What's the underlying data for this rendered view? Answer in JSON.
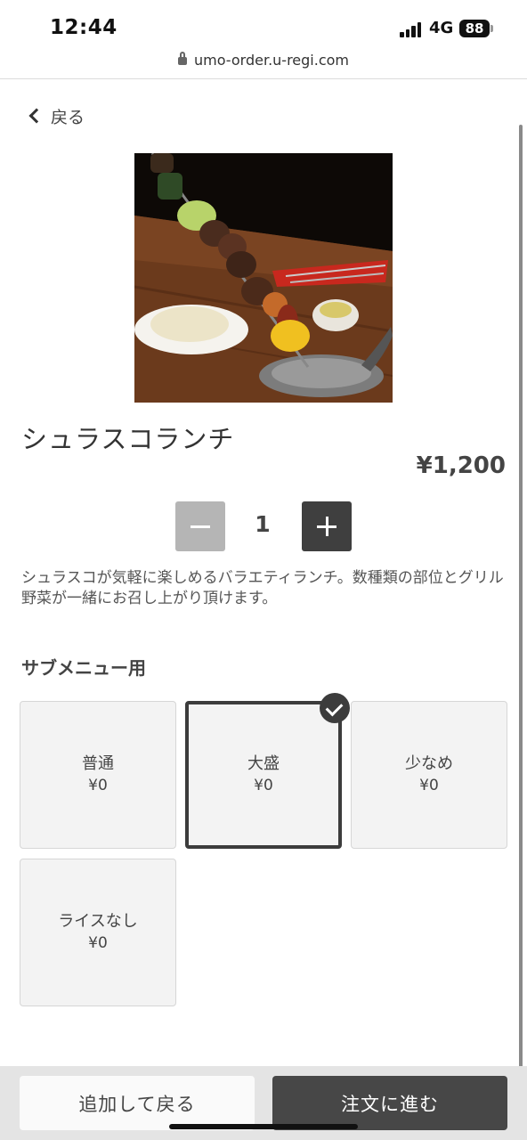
{
  "status": {
    "time": "12:44",
    "network": "4G",
    "battery": "88"
  },
  "browser": {
    "url": "umo-order.u-regi.com"
  },
  "nav": {
    "back_label": "戻る"
  },
  "product": {
    "title": "シュラスコランチ",
    "price": "¥1,200",
    "quantity": "1",
    "description": "シュラスコが気軽に楽しめるバラエティランチ。数種類の部位とグリル野菜が一緒にお召し上がり頂けます。"
  },
  "submenu": {
    "title": "サブメニュー用",
    "options": [
      {
        "name": "普通",
        "price": "¥0"
      },
      {
        "name": "大盛",
        "price": "¥0"
      },
      {
        "name": "少なめ",
        "price": "¥0"
      },
      {
        "name": "ライスなし",
        "price": "¥0"
      }
    ],
    "selected": "大盛"
  },
  "actions": {
    "add_back_label": "追加して戻る",
    "order_label": "注文に進む"
  },
  "colors": {
    "primary": "#474747",
    "disabled": "#b5b5b5",
    "option_bg": "#f3f3f3"
  }
}
